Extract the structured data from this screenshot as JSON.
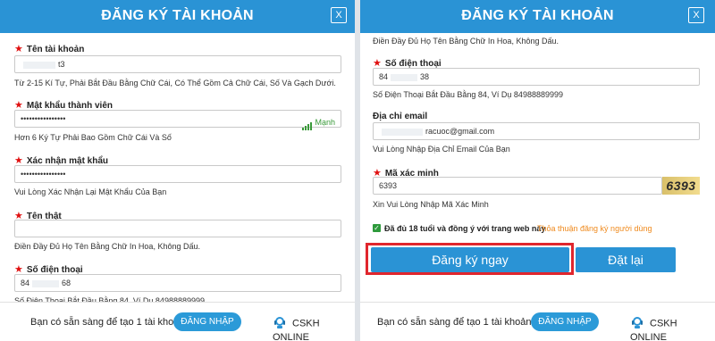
{
  "left": {
    "title": "ĐĂNG KÝ TÀI KHOẢN",
    "close": "X",
    "username": {
      "label": "Tên tài khoản",
      "value_visible": "t3",
      "hint": "Từ 2-15 Kí Tự, Phải Bắt Đầu Bằng Chữ Cái, Có Thể Gồm Cả Chữ Cái, Số Và Gạch Dưới."
    },
    "password": {
      "label": "Mật khẩu thành viên",
      "value": "••••••••••••••••",
      "strength": "Mạnh",
      "hint": "Hơn 6 Ký Tự Phải Bao Gồm Chữ Cái Và Số"
    },
    "confirm": {
      "label": "Xác nhận mật khẩu",
      "value": "••••••••••••••••",
      "hint": "Vui Lòng Xác Nhận Lại Mật Khẩu Của Bạn"
    },
    "realname": {
      "label": "Tên thật",
      "value": "",
      "hint": "Điền Đầy Đủ Họ Tên Bằng Chữ In Hoa, Không Dấu."
    },
    "phone": {
      "label": "Số điện thoại",
      "value_prefix": "84",
      "value_suffix": "68",
      "hint": "Số Điện Thoại Bắt Đầu Bằng 84, Ví Dụ 84988889999"
    },
    "footer": {
      "question": "Bạn có sẵn sàng để tạo 1 tài khoản?",
      "login": "ĐĂNG NHẬP",
      "cskh": "CSKH ONLINE"
    }
  },
  "right": {
    "title": "ĐĂNG KÝ TÀI KHOẢN",
    "close": "X",
    "name_hint": "Điền Đầy Đủ Họ Tên Bằng Chữ In Hoa, Không Dấu.",
    "phone": {
      "label": "Số điện thoại",
      "value_prefix": "84",
      "value_suffix": "38",
      "hint": "Số Điện Thoại Bắt Đầu Bằng 84, Ví Dụ 84988889999"
    },
    "email": {
      "label": "Địa chỉ email",
      "value_visible": "racuoc@gmail.com",
      "hint": "Vui Lòng Nhập Địa Chỉ Email Của Bạn"
    },
    "captcha": {
      "label": "Mã xác minh",
      "value": "6393",
      "image_text": "6393",
      "hint": "Xin Vui Lòng Nhập Mã Xác Minh"
    },
    "agree": "Đã đủ 18 tuổi và đồng ý với trang web này",
    "terms": "Thỏa thuận đăng ký người dùng",
    "register": "Đăng ký ngay",
    "reset": "Đặt lại",
    "footer": {
      "question": "Bạn có sẵn sàng để tạo 1 tài khoản?",
      "login": "ĐĂNG NHẬP",
      "cskh": "CSKH ONLINE"
    }
  },
  "colors": {
    "header": "#2a93d5",
    "required": "#e01010",
    "strength": "#3a9a3a",
    "terms": "#ef8a1e",
    "highlight": "#e0262d"
  }
}
